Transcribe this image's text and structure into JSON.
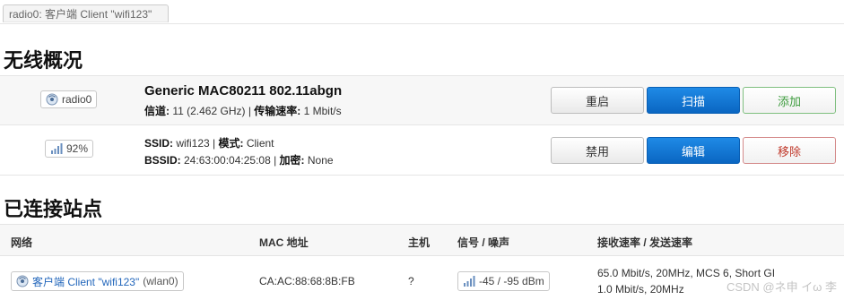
{
  "page_tab": {
    "label": "radio0: 客户端 Client \"wifi123\""
  },
  "wireless_overview": {
    "title": "无线概况",
    "radio": {
      "badge_label": "radio0",
      "device_name": "Generic MAC80211 802.11abgn",
      "channel_label": "信道:",
      "channel_value": " 11 (2.462 GHz) | ",
      "rate_label": "传输速率:",
      "rate_value": " 1 Mbit/s",
      "buttons": {
        "restart": "重启",
        "scan": "扫描",
        "add": "添加"
      }
    },
    "network": {
      "signal_percent": "92%",
      "ssid_label": "SSID:",
      "ssid_value": " wifi123 | ",
      "mode_label": "模式:",
      "mode_value": " Client",
      "bssid_label": "BSSID:",
      "bssid_value": " 24:63:00:04:25:08 | ",
      "encryption_label": "加密:",
      "encryption_value": " None",
      "buttons": {
        "disable": "禁用",
        "edit": "编辑",
        "remove": "移除"
      }
    }
  },
  "connected_stations": {
    "title": "已连接站点",
    "columns": [
      "网络",
      "MAC 地址",
      "主机",
      "信号 / 噪声",
      "接收速率 / 发送速率"
    ],
    "rows": [
      {
        "network_name": "客户端 Client \"wifi123\"",
        "network_iface": "(wlan0)",
        "mac": "CA:AC:88:68:8B:FB",
        "host": "?",
        "signal_noise": "-45 / -95 dBm",
        "rx_rate": "65.0 Mbit/s, 20MHz, MCS 6, Short GI",
        "tx_rate": "1.0 Mbit/s, 20MHz"
      }
    ]
  },
  "watermark": "CSDN @ネ申 イω 李",
  "colors": {
    "primary": "#0a66c2",
    "add": "#3d9b3d",
    "remove": "#c0392b",
    "link": "#2266bb"
  },
  "icons": {
    "radio": "wifi-radio-icon",
    "signal": "signal-bars-icon"
  }
}
